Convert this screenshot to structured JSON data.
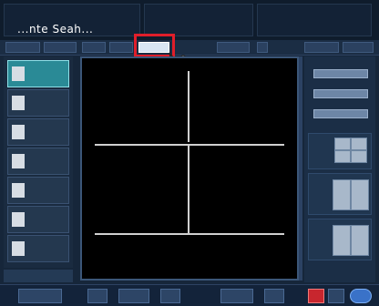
{
  "app": {
    "title": "...nte Seah..."
  }
}
